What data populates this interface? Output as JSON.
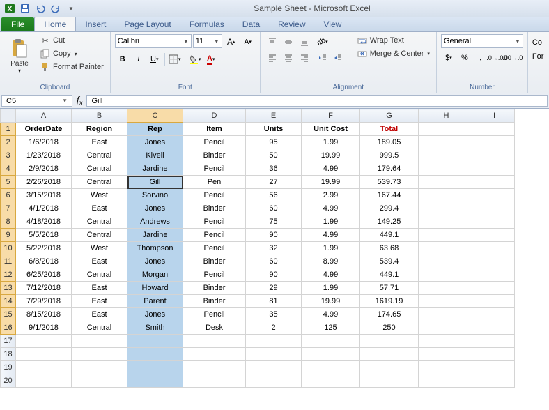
{
  "title": "Sample Sheet - Microsoft Excel",
  "ribbon": {
    "tabs": [
      "Home",
      "Insert",
      "Page Layout",
      "Formulas",
      "Data",
      "Review",
      "View"
    ],
    "file": "File",
    "clipboard": {
      "paste": "Paste",
      "cut": "Cut",
      "copy": "Copy",
      "fp": "Format Painter",
      "title": "Clipboard"
    },
    "font": {
      "name": "Calibri",
      "size": "11",
      "title": "Font"
    },
    "align": {
      "wrap": "Wrap Text",
      "merge": "Merge & Center",
      "title": "Alignment"
    },
    "number": {
      "format": "General",
      "title": "Number"
    },
    "right": {
      "co": "Co",
      "for": "For"
    }
  },
  "fb": {
    "cell": "C5",
    "value": "Gill"
  },
  "cols": [
    "A",
    "B",
    "C",
    "D",
    "E",
    "F",
    "G",
    "H",
    "I"
  ],
  "widths": [
    80,
    80,
    80,
    90,
    80,
    84,
    84,
    80,
    58
  ],
  "rows": 20,
  "selectedCol": 2,
  "activeRow": 5,
  "headers": [
    "OrderDate",
    "Region",
    "Rep",
    "Item",
    "Units",
    "Unit Cost",
    "Total"
  ],
  "chart_data": {
    "type": "table",
    "columns": [
      "OrderDate",
      "Region",
      "Rep",
      "Item",
      "Units",
      "Unit Cost",
      "Total"
    ],
    "rows": [
      [
        "1/6/2018",
        "East",
        "Jones",
        "Pencil",
        95,
        1.99,
        189.05
      ],
      [
        "1/23/2018",
        "Central",
        "Kivell",
        "Binder",
        50,
        19.99,
        999.5
      ],
      [
        "2/9/2018",
        "Central",
        "Jardine",
        "Pencil",
        36,
        4.99,
        179.64
      ],
      [
        "2/26/2018",
        "Central",
        "Gill",
        "Pen",
        27,
        19.99,
        539.73
      ],
      [
        "3/15/2018",
        "West",
        "Sorvino",
        "Pencil",
        56,
        2.99,
        167.44
      ],
      [
        "4/1/2018",
        "East",
        "Jones",
        "Binder",
        60,
        4.99,
        299.4
      ],
      [
        "4/18/2018",
        "Central",
        "Andrews",
        "Pencil",
        75,
        1.99,
        149.25
      ],
      [
        "5/5/2018",
        "Central",
        "Jardine",
        "Pencil",
        90,
        4.99,
        449.1
      ],
      [
        "5/22/2018",
        "West",
        "Thompson",
        "Pencil",
        32,
        1.99,
        63.68
      ],
      [
        "6/8/2018",
        "East",
        "Jones",
        "Binder",
        60,
        8.99,
        539.4
      ],
      [
        "6/25/2018",
        "Central",
        "Morgan",
        "Pencil",
        90,
        4.99,
        449.1
      ],
      [
        "7/12/2018",
        "East",
        "Howard",
        "Binder",
        29,
        1.99,
        57.71
      ],
      [
        "7/29/2018",
        "East",
        "Parent",
        "Binder",
        81,
        19.99,
        1619.19
      ],
      [
        "8/15/2018",
        "East",
        "Jones",
        "Pencil",
        35,
        4.99,
        174.65
      ],
      [
        "9/1/2018",
        "Central",
        "Smith",
        "Desk",
        2,
        125,
        250
      ]
    ]
  }
}
